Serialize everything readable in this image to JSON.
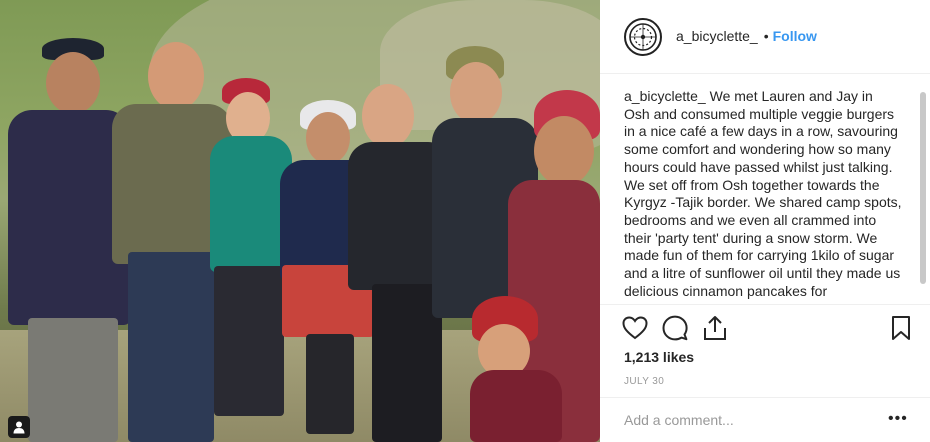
{
  "post": {
    "username": "a_bicyclette_",
    "separator": "•",
    "follow_label": "Follow",
    "caption_user": "a_bicyclette_",
    "caption_text": " We met Lauren and Jay in Osh and consumed multiple veggie burgers in a nice café a few days in a row, savouring some comfort and wondering how so many hours could have passed whilst just talking. We set off from Osh together towards the Kyrgyz -Tajik border. We shared camp spots, bedrooms and we even all crammed into their 'party tent' during a snow storm. We made fun of them for carrying 1kilo of sugar and a litre of sunflower oil until they made us delicious cinnamon pancakes for",
    "likes": "1,213 likes",
    "date": "JULY 30",
    "comment_placeholder": "Add a comment...",
    "more_label": "•••"
  },
  "icons": {
    "like": "heart-icon",
    "comment": "comment-icon",
    "share": "share-icon",
    "save": "bookmark-icon",
    "profile_tag": "person-icon"
  },
  "colors": {
    "follow": "#3897f0",
    "muted": "#999999",
    "text": "#262626"
  }
}
